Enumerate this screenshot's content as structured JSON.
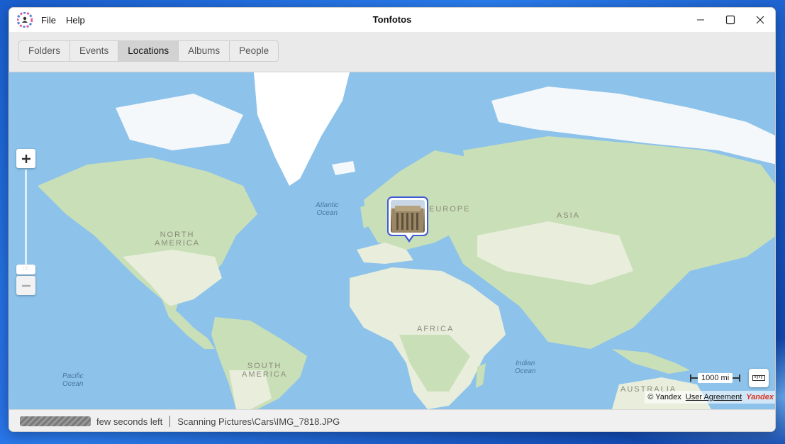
{
  "window": {
    "title": "Tonfotos",
    "menu": [
      "File",
      "Help"
    ]
  },
  "tabs": [
    {
      "label": "Folders",
      "active": false
    },
    {
      "label": "Events",
      "active": false
    },
    {
      "label": "Locations",
      "active": true
    },
    {
      "label": "Albums",
      "active": false
    },
    {
      "label": "People",
      "active": false
    }
  ],
  "map": {
    "continents": {
      "north_america": "NORTH\nAMERICA",
      "south_america": "SOUTH\nAMERICA",
      "europe": "EUROPE",
      "asia": "ASIA",
      "africa": "AFRICA",
      "australia": "AUSTRALIA"
    },
    "oceans": {
      "atlantic": "Atlantic\nOcean",
      "pacific": "Pacific\nOcean",
      "indian": "Indian\nOcean"
    },
    "scale_label": "1000 mi",
    "copyright": "© Yandex",
    "agreement_link": "User Agreement",
    "brand": "Yandex",
    "colors": {
      "water": "#8dc2ea",
      "land": "#e8eedb",
      "forest": "#c9dfb8",
      "ice": "#ffffff",
      "marker_border": "#3f5bd6"
    }
  },
  "status": {
    "progress": 1.0,
    "time_left": "few seconds left",
    "scanning": "Scanning Pictures\\Cars\\IMG_7818.JPG"
  }
}
